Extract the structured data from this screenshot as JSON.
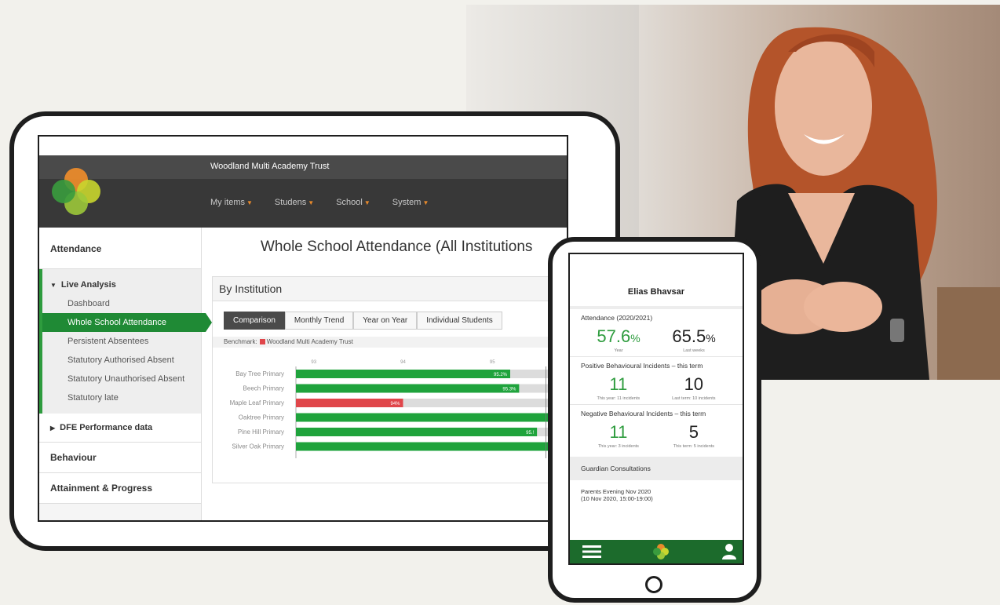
{
  "colors": {
    "accent_green": "#2e9c3e",
    "alert_red": "#e0464a",
    "nav_dark": "#383838",
    "nav_caret": "#e98a2b"
  },
  "app": {
    "org_name": "Woodland Multi Academy Trust",
    "nav": [
      {
        "label": "My items"
      },
      {
        "label": "Studens"
      },
      {
        "label": "School"
      },
      {
        "label": "System"
      }
    ],
    "sidebar": {
      "heading": "Attendance",
      "group_title": "Live Analysis",
      "items": [
        "Dashboard",
        "Whole School Attendance",
        "Persistent Absentees",
        "Statutory Authorised Absent",
        "Statutory Unauthorised Absent",
        "Statutory late"
      ],
      "active_index": 1,
      "dfe": "DFE Performance data",
      "behaviour": "Behaviour",
      "attainment": "Attainment & Progress"
    },
    "main_title": "Whole School Attendance (All Institutions",
    "panel_title": "By Institution",
    "tabs": [
      "Comparison",
      "Monthly Trend",
      "Year on Year",
      "Individual Students"
    ],
    "benchmark_label": "Benchmark:",
    "benchmark_name": "Woodland Multi Academy Trust"
  },
  "chart_data": {
    "type": "bar",
    "orientation": "horizontal",
    "x_ticks": [
      "93",
      "94",
      "95"
    ],
    "categories": [
      "Bay Tree Primary",
      "Beech Primary",
      "Maple Leaf Primary",
      "Oaktree Primary",
      "Pine Hill Primary",
      "Silver Oak Primary"
    ],
    "values": [
      95.2,
      95.3,
      94.0,
      95.8,
      95.5,
      95.8
    ],
    "data_labels": [
      "95.2%",
      "95.3%",
      "94%",
      "",
      "95.!",
      ""
    ],
    "xlim": [
      92.8,
      96.0
    ],
    "benchmark": 95.6,
    "bar_colors": [
      "#1fa33c",
      "#1fa33c",
      "#e0464a",
      "#1fa33c",
      "#1fa33c",
      "#1fa33c"
    ]
  },
  "phone": {
    "student_name": "Elias Bhavsar",
    "attendance": {
      "title": "Attendance (2020/2021)",
      "stats": [
        {
          "value": "57.6",
          "unit": "%",
          "caption": "Year",
          "color": "#2e9c3e"
        },
        {
          "value": "65.5",
          "unit": "%",
          "caption": "Last weeks",
          "color": "#222222"
        }
      ]
    },
    "positive": {
      "title": "Positive Behavioural Incidents – this term",
      "stats": [
        {
          "value": "11",
          "caption": "This year: 11 incidents"
        },
        {
          "value": "10",
          "caption": "Last term: 10 incidents"
        }
      ]
    },
    "negative": {
      "title": "Negative Behavioural Incidents – this term",
      "stats": [
        {
          "value": "11",
          "caption": "This year: 3 incidents"
        },
        {
          "value": "5",
          "caption": "This term: 5 incidents"
        }
      ]
    },
    "guardian": "Guardian Consultations",
    "event_line1": "Parents Evening Nov 2020",
    "event_line2": "(10 Nov 2020, 15:00-19:00)"
  }
}
